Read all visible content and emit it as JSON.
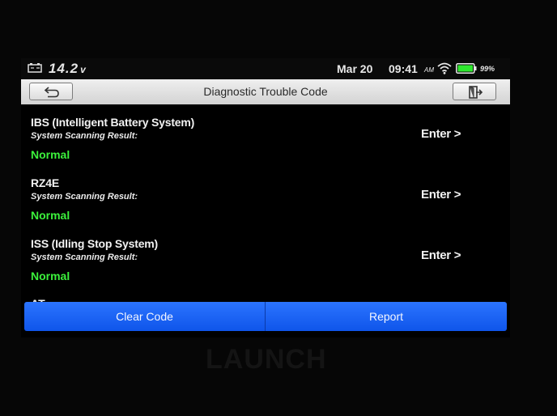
{
  "status_bar": {
    "voltage": "14.2",
    "voltage_unit": "v",
    "date": "Mar 20",
    "time": "09:41",
    "ampm": "AM",
    "battery_percent": "99%",
    "icons": [
      "battery-small-icon",
      "wifi-icon",
      "battery-icon"
    ]
  },
  "title_bar": {
    "title": "Diagnostic Trouble Code",
    "back_icon": "back-arrow-icon",
    "exit_icon": "exit-door-icon"
  },
  "systems": [
    {
      "name": "IBS (Intelligent Battery System)",
      "label": "System Scanning Result:",
      "result": "Normal",
      "enter": "Enter >"
    },
    {
      "name": "RZ4E",
      "label": "System Scanning Result:",
      "result": "Normal",
      "enter": "Enter >"
    },
    {
      "name": "ISS (Idling Stop System)",
      "label": "System Scanning Result:",
      "result": "Normal",
      "enter": "Enter >"
    }
  ],
  "partial_next_item": "AT",
  "bottom_bar": {
    "clear_code": "Clear Code",
    "report": "Report"
  },
  "device": {
    "brand": "LAUNCH"
  },
  "colors": {
    "result_ok": "#3cf23c",
    "button_blue": "#1a62f5",
    "title_bar": "#e0e0e0"
  }
}
